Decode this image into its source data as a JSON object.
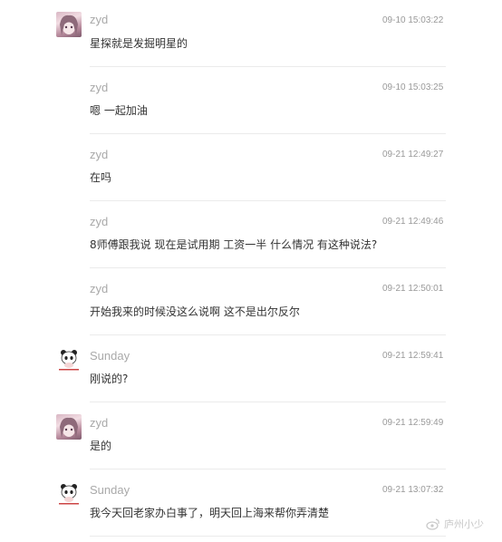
{
  "messages": [
    {
      "author": "zyd",
      "time": "09-10 15:03:22",
      "text": "星探就是发掘明星的",
      "avatar": "anime-girl-avatar"
    },
    {
      "author": "zyd",
      "time": "09-10 15:03:25",
      "text": "嗯 一起加油",
      "avatar": null
    },
    {
      "author": "zyd",
      "time": "09-21 12:49:27",
      "text": "在吗",
      "avatar": null
    },
    {
      "author": "zyd",
      "time": "09-21 12:49:46",
      "text": "8师傅跟我说 现在是试用期 工资一半 什么情况 有这种说法?",
      "avatar": null
    },
    {
      "author": "zyd",
      "time": "09-21 12:50:01",
      "text": "开始我来的时候没这么说啊 这不是出尔反尔",
      "avatar": null
    },
    {
      "author": "Sunday",
      "time": "09-21 12:59:41",
      "text": "刚说的?",
      "avatar": "panda-avatar"
    },
    {
      "author": "zyd",
      "time": "09-21 12:59:49",
      "text": "是的",
      "avatar": "anime-girl-avatar"
    },
    {
      "author": "Sunday",
      "time": "09-21 13:07:32",
      "text": "我今天回老家办白事了，明天回上海来帮你弄清楚",
      "avatar": "panda-avatar"
    }
  ],
  "watermark": {
    "text": "庐州小少",
    "icon": "weibo-logo-icon"
  },
  "colors": {
    "author": "#a9a9a9",
    "time": "#999999",
    "text": "#333333",
    "divider": "#ebebeb"
  }
}
